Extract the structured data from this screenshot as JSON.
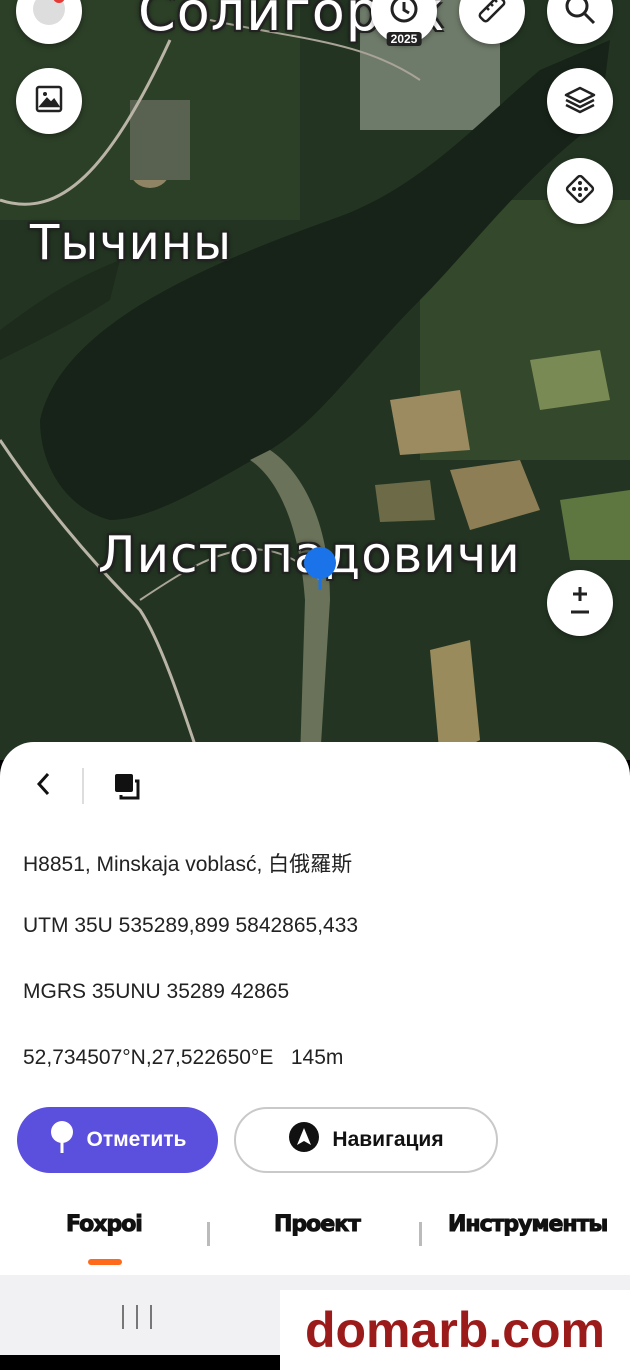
{
  "map": {
    "labels": {
      "top_city": "Солигорск",
      "village_1": "Тычины",
      "village_2": "Листопадовичи"
    },
    "timeline_year": "2025",
    "icons": [
      "avatar-icon",
      "history-icon",
      "ruler-icon",
      "search-icon",
      "image-icon",
      "layers-icon",
      "dice-icon",
      "zoom-plus-minus-icon",
      "location-pin-icon"
    ]
  },
  "sheet": {
    "address": "H8851, Minskaja voblasć, 白俄羅斯",
    "utm": "UTM 35U 535289,899 5842865,433",
    "mgrs": "MGRS 35UNU 35289 42865",
    "coords": "52,734507°N,27,522650°E   145m",
    "mark_button": "Отметить",
    "navigate_button": "Навигация",
    "tabs": [
      "Foxpoi",
      "Проект",
      "Инструменты"
    ],
    "active_tab": "Foxpoi"
  },
  "watermark": "domarb.com",
  "colors": {
    "accent": "#5b4fde",
    "tab_indicator": "#ff6a1a",
    "watermark": "#9b1b1b"
  }
}
